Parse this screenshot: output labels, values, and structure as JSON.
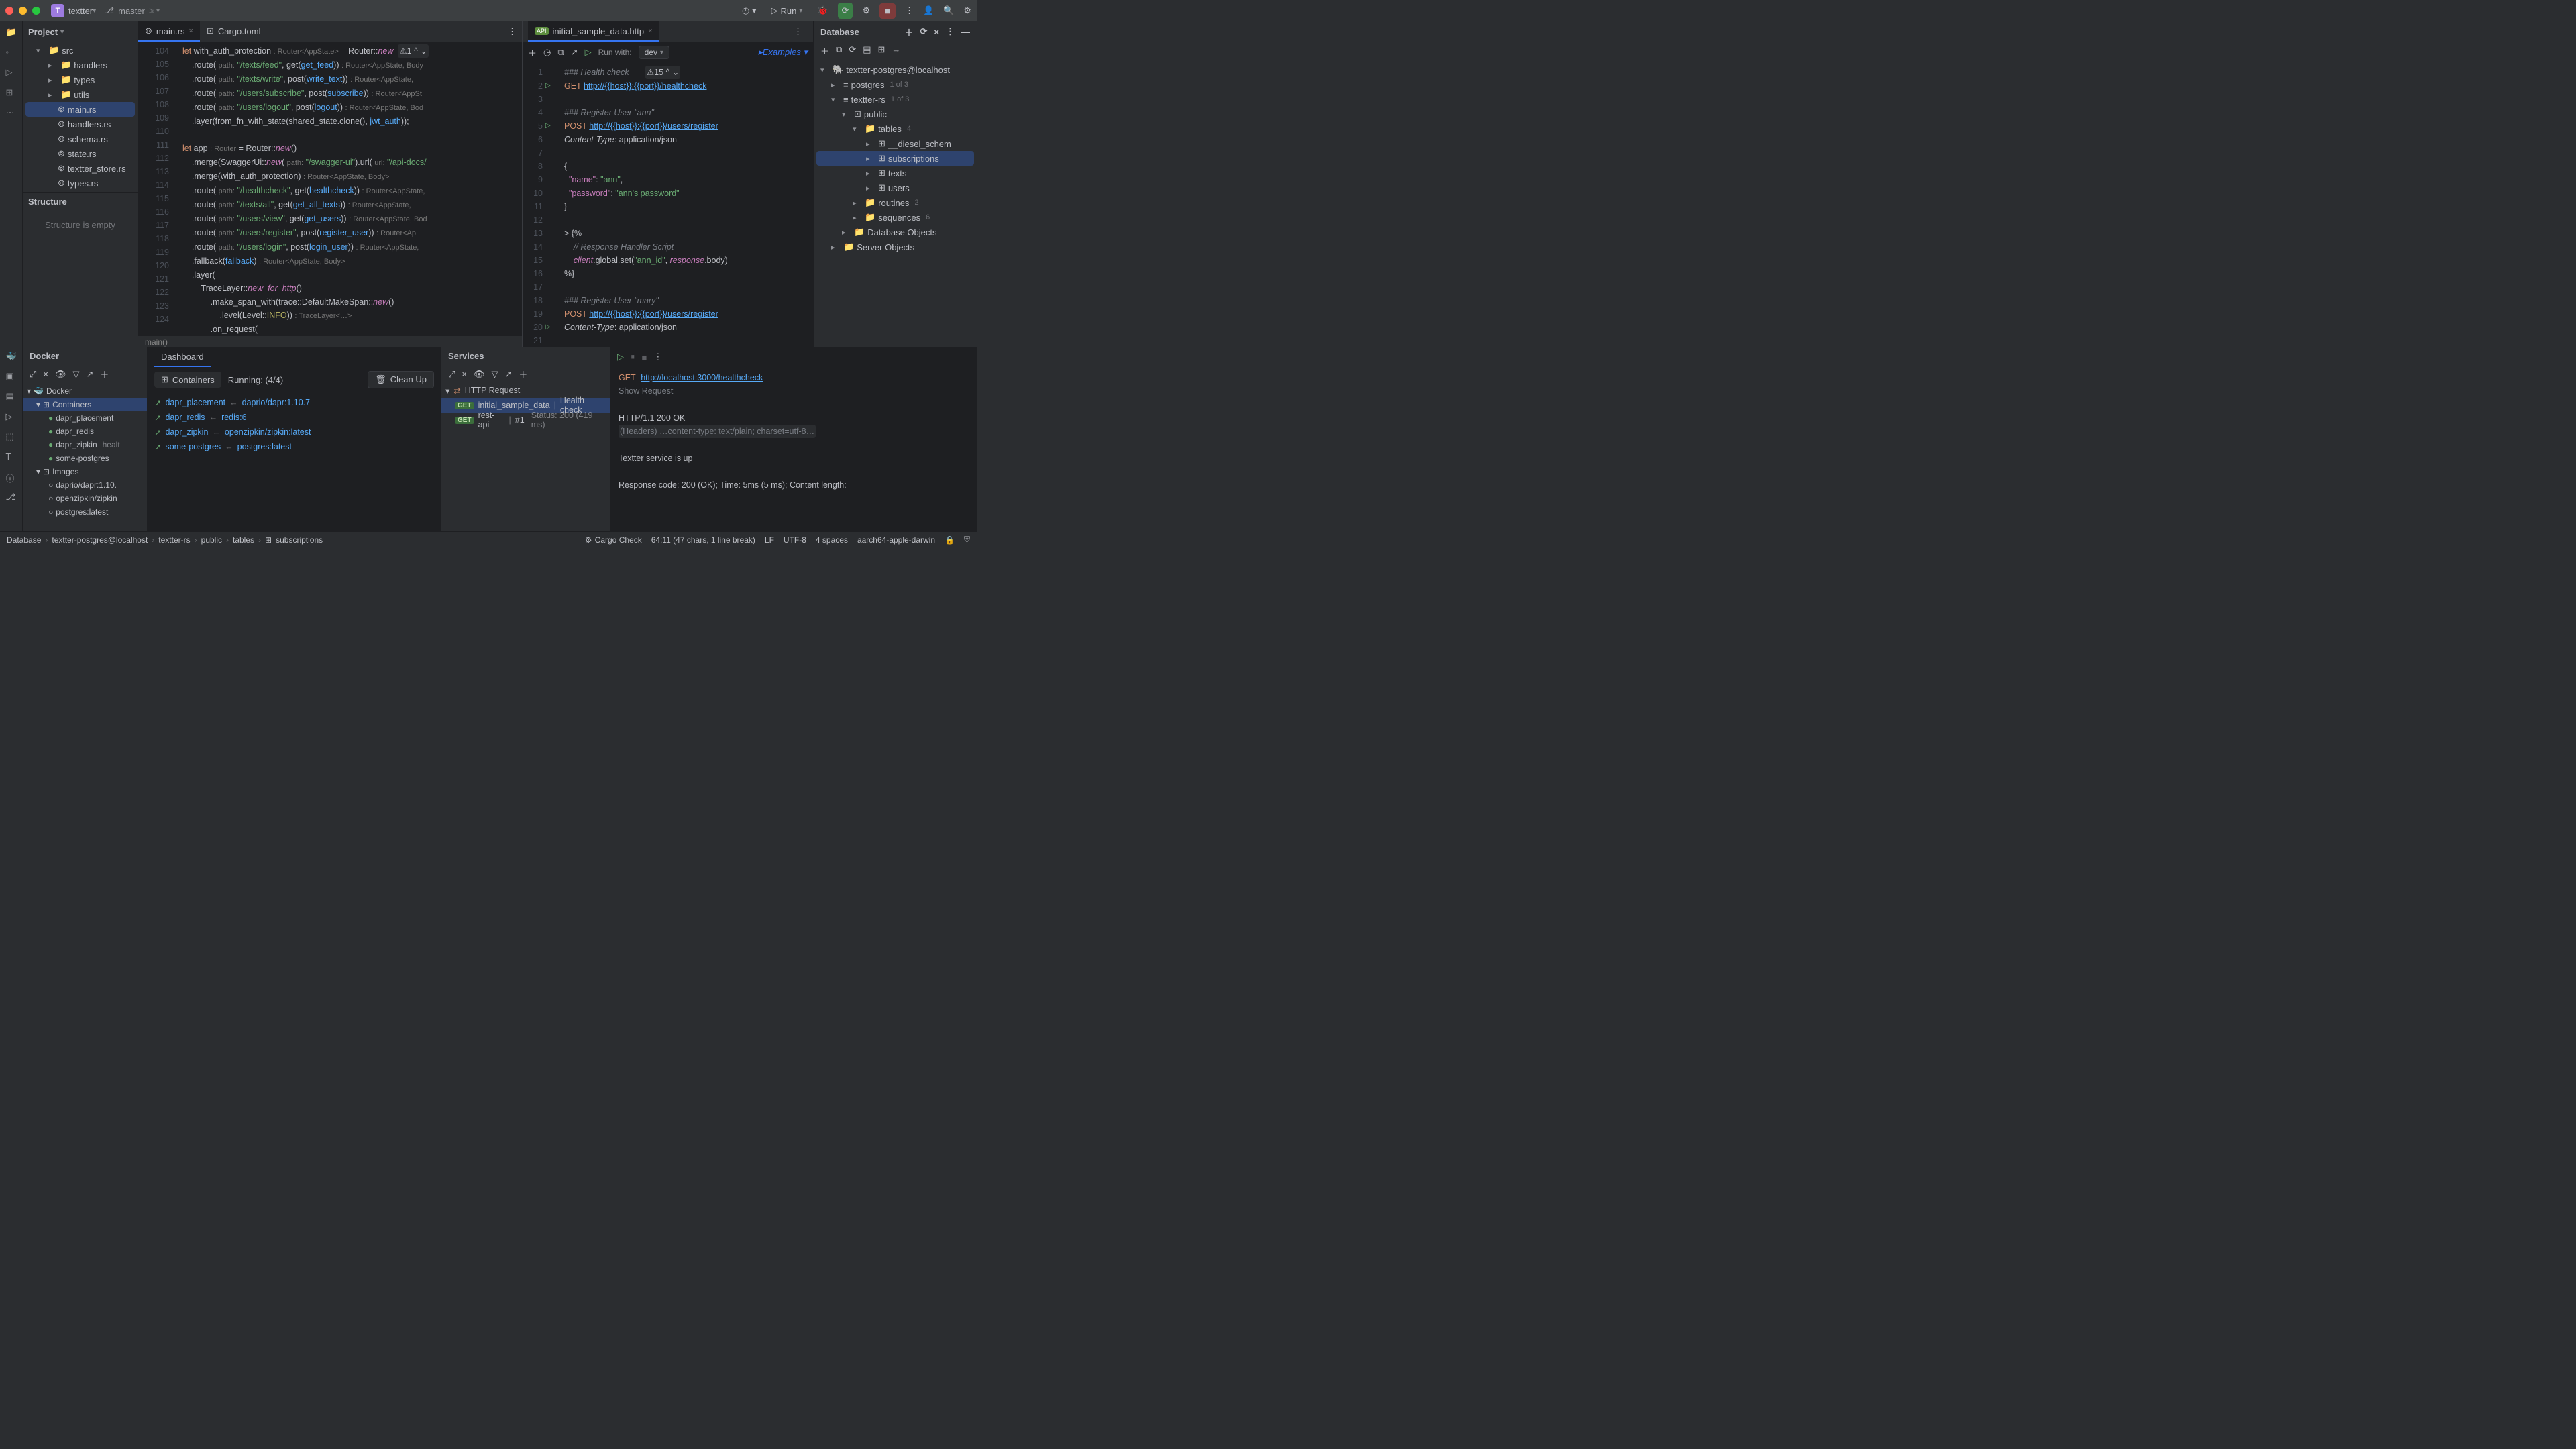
{
  "title": {
    "project": "textter",
    "branch": "master",
    "run_label": "Run"
  },
  "project_tree": {
    "header": "Project",
    "root": "src",
    "items": [
      "handlers",
      "types",
      "utils",
      "main.rs",
      "handlers.rs",
      "schema.rs",
      "state.rs",
      "textter_store.rs",
      "types.rs"
    ],
    "selected": "main.rs",
    "structure_header": "Structure",
    "structure_empty": "Structure is empty"
  },
  "editor": {
    "tabs": [
      {
        "name": "main.rs",
        "active": true
      },
      {
        "name": "Cargo.toml",
        "active": false
      }
    ],
    "gutter_start": 104,
    "gutter_end": 124,
    "breadcrumb": "main()"
  },
  "http": {
    "tab": "initial_sample_data.http",
    "run_with": "Run with:",
    "env": "dev",
    "examples": "Examples",
    "warn_count": "15",
    "gutter_start": 1,
    "gutter_end": 21
  },
  "database": {
    "header": "Database",
    "root": "textter-postgres@localhost",
    "postgres": {
      "label": "postgres",
      "count": "1 of 3"
    },
    "ttrs": {
      "label": "textter-rs",
      "count": "1 of 3"
    },
    "schema": "public",
    "tables_label": "tables",
    "tables_count": "4",
    "tables": [
      "__diesel_schem",
      "subscriptions",
      "texts",
      "users"
    ],
    "selected": "subscriptions",
    "routines": {
      "label": "routines",
      "count": "2"
    },
    "sequences": {
      "label": "sequences",
      "count": "6"
    },
    "db_objects": "Database Objects",
    "server_objects": "Server Objects"
  },
  "docker": {
    "title": "Docker",
    "dashboard_tab": "Dashboard",
    "containers_label": "Containers",
    "running": "Running: (4/4)",
    "cleanup": "Clean Up",
    "tree_root": "Docker",
    "tree_containers": "Containers",
    "tree_items": [
      "dapr_placement",
      "dapr_redis",
      "dapr_zipkin",
      "some-postgres"
    ],
    "zipkin_health": "healt",
    "tree_images": "Images",
    "image_items": [
      "daprio/dapr:1.10.",
      "openzipkin/zipkin",
      "postgres:latest"
    ],
    "list": [
      {
        "name": "dapr_placement",
        "img": "daprio/dapr:1.10.7"
      },
      {
        "name": "dapr_redis",
        "img": "redis:6"
      },
      {
        "name": "dapr_zipkin",
        "img": "openzipkin/zipkin:latest"
      },
      {
        "name": "some-postgres",
        "img": "postgres:latest"
      }
    ]
  },
  "services": {
    "title": "Services",
    "root": "HTTP Request",
    "items": [
      {
        "name": "initial_sample_data",
        "tail": "Health check",
        "sel": true
      },
      {
        "name": "rest-api",
        "tail": "#1",
        "status": "Status: 200 (419 ms)"
      }
    ],
    "output": {
      "line1_meth": "GET",
      "line1_url": "http://localhost:3000/healthcheck",
      "show_req": "Show Request",
      "status_line": "HTTP/1.1 200 OK",
      "headers": "(Headers) …content-type: text/plain; charset=utf-8…",
      "body": "Textter service is up",
      "footer": "Response code: 200 (OK); Time: 5ms (5 ms); Content length: "
    }
  },
  "status": {
    "crumbs": [
      "Database",
      "textter-postgres@localhost",
      "textter-rs",
      "public",
      "tables",
      "subscriptions"
    ],
    "cargo": "Cargo Check",
    "pos": "64:11 (47 chars, 1 line break)",
    "le": "LF",
    "enc": "UTF-8",
    "indent": "4 spaces",
    "arch": "aarch64-apple-darwin"
  }
}
